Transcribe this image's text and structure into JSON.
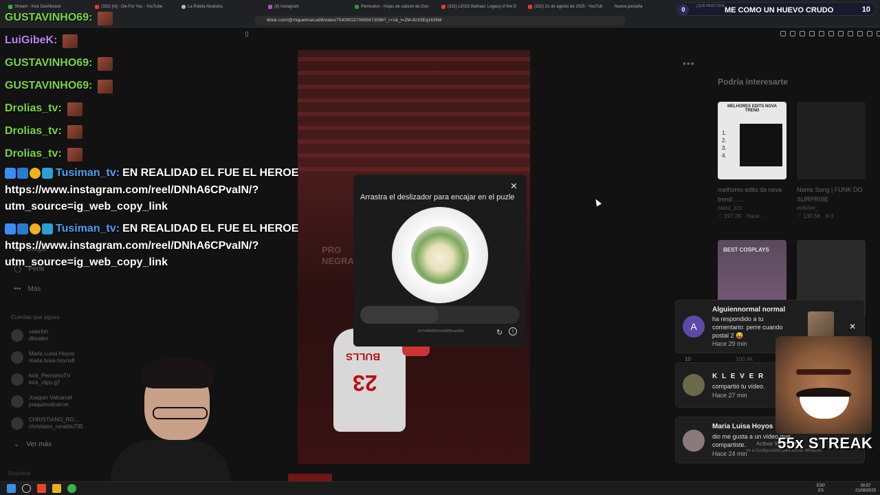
{
  "browser": {
    "tabs": [
      {
        "label": "Stream - Kick Dashboard",
        "fav": "k"
      },
      {
        "label": "(332) [ni] - Die For You - YouTube",
        "fav": "y"
      },
      {
        "label": "La Ruleta Aleatoria",
        "fav": "w"
      },
      {
        "label": "(9) Instagram",
        "fav": "p"
      },
      {
        "label": "Perreudos - Hojas de cálculo de Goo",
        "fav": "g"
      },
      {
        "label": "(332) LEGO Batman: Legacy of the D",
        "fav": "y"
      },
      {
        "label": "(332) 21 de agosto de 2025 - YouTub",
        "fav": "y"
      },
      {
        "label": "Nueva pestaña",
        "fav": "none"
      }
    ],
    "url": "tiktok.com/@miguelmarca98/video/7540902270695673096?_r=1&_t=ZM-8z3SEq1635M"
  },
  "now_playing": {
    "badge": "0",
    "subtitle": "¿QUÉ PASÓ CON...",
    "title": "ME COMO UN HUEVO CRUDO",
    "count": "10"
  },
  "chat": {
    "simple_lines": [
      {
        "user": "GUSTAVINHO69:",
        "color": "green"
      },
      {
        "user": "LuiGibeK:",
        "color": "purple"
      },
      {
        "user": "GUSTAVINHO69:",
        "color": "green"
      },
      {
        "user": "GUSTAVINHO69:",
        "color": "green"
      },
      {
        "user": "Drolias_tv:",
        "color": "green"
      },
      {
        "user": "Drolias_tv:",
        "color": "green"
      },
      {
        "user": "Drolias_tv:",
        "color": "green"
      }
    ],
    "messages": [
      {
        "user": "Tusiman_tv:",
        "text": "EN REALIDAD EL FUE EL HEROE",
        "line2": "https://www.instagram.com/reel/DNhA6CPvaIN/?",
        "line3": "utm_source=ig_web_copy_link"
      },
      {
        "user": "Tusiman_tv:",
        "text": "EN REALIDAD EL FUE EL HEROE",
        "line2": "https://www.instagram.com/reel/DNhA6CPvaIN/?",
        "line3": "utm_source=ig_web_copy_link"
      }
    ]
  },
  "sidebar": {
    "items": [
      "Cargar",
      "Perfil",
      "Más"
    ],
    "following_header": "Cuentas que sigues",
    "following": [
      {
        "name": "valerihh",
        "handle": "dbvaleri"
      },
      {
        "name": "Maria Luisa Hoyos",
        "handle": "maria.luisa.hoyos8"
      },
      {
        "name": "kick_PerrismoTV",
        "handle": "kick_clips.g7"
      },
      {
        "name": "Joaquin Valcarcel",
        "handle": "joaquinvalcarcel"
      },
      {
        "name": "CHRISTIANO_RO...",
        "handle": "christiano_ronaldo735"
      }
    ],
    "see_more": "Ver más",
    "empresa": "Empresa"
  },
  "video": {
    "banner": [
      "PRO",
      "NEGRA"
    ],
    "jersey_text": "BULLS",
    "jersey_number": "23"
  },
  "captcha": {
    "title": "Arrastra el deslizador para encajar en el puzle",
    "slider_progress": 0.49,
    "meta": "b57b4ff0f5966e9d68f6aa4d8b"
  },
  "suggestions": {
    "title": "Podría interesarte",
    "cards": [
      {
        "caption": "melhores edits da nova trend . ....",
        "author": "caioz_zzz",
        "stats": "♡ 197.2K · Hace...",
        "head": "MELHORES EDITS NOVA TREND",
        "list": [
          "1.",
          "2.",
          "3.",
          "4."
        ]
      },
      {
        "caption": "Name Song | FUNK DO SURPRISE",
        "author": "evilxiter_",
        "stats": "♡ 130.5K · 8-3"
      },
      {
        "caption": "BEST COSPLAYS"
      }
    ]
  },
  "notifications": [
    {
      "title": "Alguiennormal normal",
      "body1": "ha respondido a tu",
      "body2": "comentario: perre cuando",
      "body3": "postal 2 😝",
      "time": "Hace 29 min",
      "avatar_letter": "A"
    },
    {
      "title": "K L E V E R",
      "body1": "compartió tu vídeo.",
      "time": "Hace 27 min"
    },
    {
      "title": "Maria Luisa Hoyos",
      "body1": "dio me gusta a un vídeo que",
      "body2": "compartiste.",
      "time": "Hace 24 min"
    }
  ],
  "notif_count": "10",
  "notif_count2": "100.4K",
  "overlay": {
    "streak": "55x STREAK",
    "activate": "Activar Windows",
    "activate2": "Ve a Configuración para activar Windows."
  },
  "taskbar": {
    "lang": "ESP",
    "lang2": "ES",
    "time": "00:57",
    "date": "21/08/2025"
  }
}
